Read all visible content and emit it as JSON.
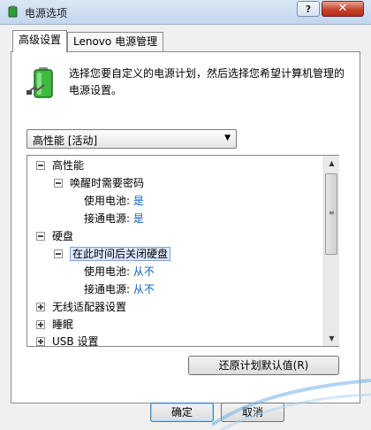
{
  "window": {
    "title": "电源选项",
    "help_label": "?",
    "close_label": "✕"
  },
  "tabs": [
    {
      "label": "高级设置",
      "active": true
    },
    {
      "label": "Lenovo 电源管理",
      "active": false
    }
  ],
  "description": "选择您要自定义的电源计划，然后选择您希望计算机管理的电源设置。",
  "plan_select": {
    "value": "高性能 [活动]"
  },
  "tree": {
    "n0": "高性能",
    "n1": "唤醒时需要密码",
    "n1_battery_label": "使用电池:",
    "n1_battery_value": "是",
    "n1_ac_label": "接通电源:",
    "n1_ac_value": "是",
    "n2": "硬盘",
    "n3": "在此时间后关闭硬盘",
    "n3_battery_label": "使用电池:",
    "n3_battery_value": "从不",
    "n3_ac_label": "接通电源:",
    "n3_ac_value": "从不",
    "n4": "无线适配器设置",
    "n5": "睡眠",
    "n6": "USB 设置"
  },
  "buttons": {
    "restore": "还原计划默认值(R)",
    "ok": "确定",
    "cancel": "取消"
  },
  "colors": {
    "value_text": "#0c5fb8",
    "close_red": "#c7432c"
  }
}
